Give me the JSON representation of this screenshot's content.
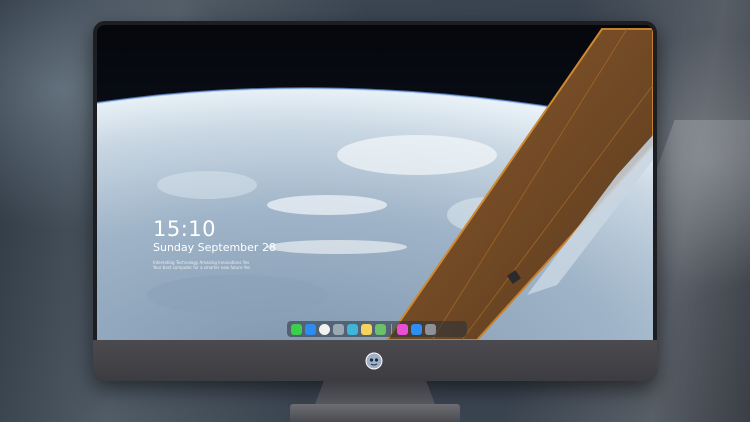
{
  "lock_screen": {
    "time": "15:10",
    "date": "Sunday September 28",
    "caption_line1": "Interesting Technology Amazing Innovations Yes",
    "caption_line2": "Your best computer for a smarter new future Yes"
  },
  "dock": {
    "apps": [
      {
        "icon": "messages-icon",
        "color": "#3ccf4e"
      },
      {
        "icon": "finder-icon",
        "color": "#2d8cf0"
      },
      {
        "icon": "clock-icon",
        "color": "#f2f2f2"
      },
      {
        "icon": "notes-icon",
        "color": "#9aa7b4"
      },
      {
        "icon": "clapper-icon",
        "color": "#3fb6d8"
      },
      {
        "icon": "memo-icon",
        "color": "#f4d35e"
      },
      {
        "icon": "photos-icon",
        "color": "#6cc06c"
      },
      {
        "icon": "music-icon",
        "color": "#e94fd6"
      },
      {
        "icon": "app-store-icon",
        "color": "#2e8ef5"
      },
      {
        "icon": "camera-icon",
        "color": "#8d9299"
      }
    ]
  },
  "colors": {
    "screen_bezel": "#1c1e22",
    "chin": "#46454a",
    "solar_panel": "#b06a2a"
  }
}
